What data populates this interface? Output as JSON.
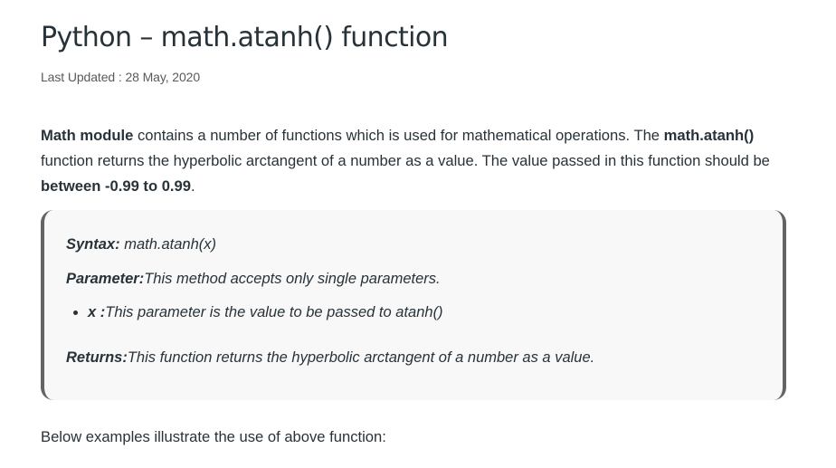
{
  "article": {
    "title": "Python – math.atanh() function",
    "last_updated": "Last Updated : 28 May, 2020",
    "intro": {
      "bold_module": "Math module",
      "text1": " contains a number of functions which is used for mathematical operations. The ",
      "bold_func": "math.atanh()",
      "text2": " function returns the hyperbolic arctangent of a number as a value. The value passed in this function should be ",
      "bold_range": "between -0.99 to 0.99",
      "text3": "."
    },
    "box": {
      "syntax_label": "Syntax:",
      "syntax_value": " math.atanh(x)",
      "parameter_label": "Parameter:",
      "parameter_value": "This method accepts only single parameters.",
      "param_items": [
        {
          "name": "x :",
          "desc": "This parameter is the value to be passed to atanh()"
        }
      ],
      "returns_label": "Returns:",
      "returns_value": "This function returns the hyperbolic arctangent of a number as a value."
    },
    "outro": "Below examples illustrate the use of above function:"
  }
}
